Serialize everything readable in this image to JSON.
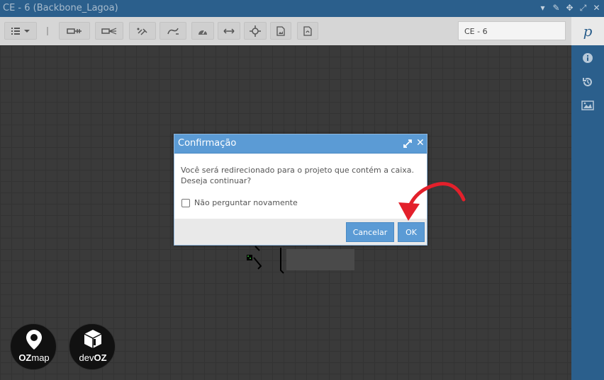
{
  "window": {
    "title": "CE - 6 (Backbone_Lagoa)",
    "controls": [
      "pin-icon",
      "edit-icon",
      "move-icon",
      "expand-icon",
      "close-icon"
    ]
  },
  "toolbar": {
    "buttons": [
      "list-icon",
      "cable-icon",
      "splitter-icon",
      "link-icon",
      "unlink-icon",
      "gauge-icon",
      "arrows-horizontal-icon",
      "crosshair-icon",
      "image-file-icon",
      "pdf-file-icon"
    ],
    "search_value": "CE - 6"
  },
  "right_sidebar": {
    "top_label": "p",
    "icons": [
      "info-icon",
      "history-icon",
      "image-icon"
    ]
  },
  "modal": {
    "title": "Confirmação",
    "message_line1": "Você será redirecionado para o projeto que contém a caixa.",
    "message_line2": "Deseja continuar?",
    "checkbox_label": "Não perguntar novamente",
    "cancel_label": "Cancelar",
    "ok_label": "OK"
  },
  "logos": {
    "ozmap": {
      "name": "OZmap",
      "text_a": "OZ",
      "text_b": "map"
    },
    "devoz": {
      "name": "devOZ",
      "text_a": "dev",
      "text_b": "OZ"
    }
  },
  "colors": {
    "accent": "#5b9bd5",
    "titlebar": "#2b5f8c",
    "annotation_arrow": "#e3202b"
  }
}
